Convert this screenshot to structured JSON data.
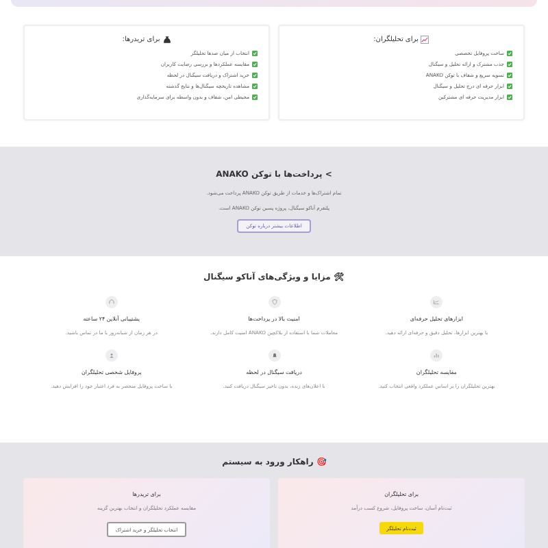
{
  "roles": [
    {
      "kind": "analyst",
      "title": "برای تحلیلگران:",
      "items": [
        "ساخت پروفایل تخصصی",
        "جذب مشترک و ارائه تحلیل و سیگنال",
        "تسویه سریع و شفاف با توکن ANAKO",
        "ابزار حرفه ای درج تحلیل و سیگنال",
        "ابزار مدیریت حرفه ای مشترکین"
      ]
    },
    {
      "kind": "trader",
      "title": "برای تریدرها:",
      "items": [
        "انتخاب از میان صدها تحلیلگر",
        "مقایسه عملکردها و بررسی رضایت کاربران",
        "خرید اشتراک و دریافت سیگنال در لحظه",
        "مشاهده تاریخچه سیگنال‌ها و نتایج گذشته",
        "محیطی امن، شفاف و بدون واسطه برای سرمایه‌گذاری"
      ]
    }
  ],
  "token": {
    "title": "> پرداخت‌ها با توکن ANAKO",
    "lines": [
      "تمام اشتراک‌ها و خدمات از طریق توکن ANAKO پرداخت می‌شود.",
      "پلتفرم آناکو سیگنال، پروژه پسین توکن ANAKO است."
    ],
    "button": "اطلاعات بیشتر درباره توکن"
  },
  "features": {
    "title": "🛠 مزایا و ویژگی‌های آناکو سیگنال",
    "items": [
      {
        "kind": "chart",
        "title": "ابزارهای تحلیل حرفه‌ای",
        "text": "با بهترین ابزارها، تحلیل دقیق و حرفه‌ای ارائه دهید."
      },
      {
        "kind": "shield",
        "title": "امنیت بالا در پرداخت‌ها",
        "text": "معاملات شما با استفاده از بلاکچین ANAKO امنیت کامل دارند."
      },
      {
        "kind": "support",
        "title": "پشتیبانی آنلاین ۲۴ ساعته",
        "text": "در هر زمان از شبانه‌روز با ما در تماس باشید."
      },
      {
        "kind": "compare",
        "title": "مقایسه تحلیلگران",
        "text": "بهترین تحلیلگران را بر اساس عملکرد واقعی انتخاب کنید."
      },
      {
        "kind": "bell",
        "title": "دریافت سیگنال در لحظه",
        "text": "با اعلان‌های زنده، بدون تاخیر سیگنال دریافت کنید."
      },
      {
        "kind": "profile",
        "title": "پروفایل شخصی تحلیلگران",
        "text": "با ساخت پروفایل منحصر به فرد اعتبار خود را افزایش دهید."
      }
    ]
  },
  "entry": {
    "title": "🎯 راهکار ورود به سیستم",
    "cards": [
      {
        "kind": "primary",
        "title": "برای تحلیلگران",
        "text": "ثبت‌نام آسان، ساخت پروفایل، شروع کسب درآمد",
        "button": "ثبت‌نام تحلیلگر"
      },
      {
        "kind": "outline",
        "title": "برای تریدرها",
        "text": "مقایسه عملکرد تحلیلگران و انتخاب بهترین گزینه",
        "button": "انتخاب تحلیلگر و خرید اشتراک"
      }
    ]
  }
}
